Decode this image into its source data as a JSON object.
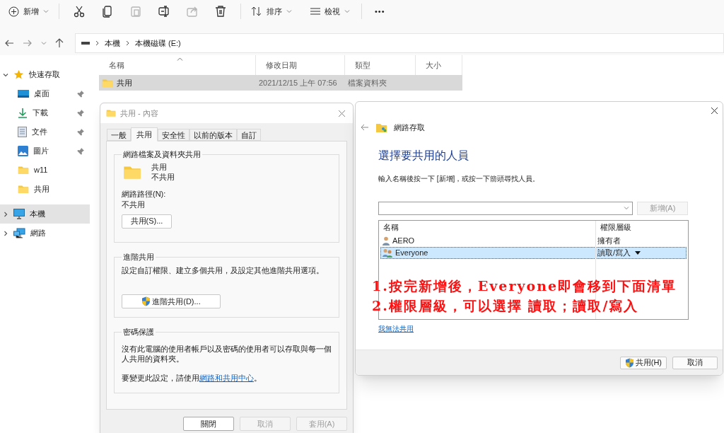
{
  "toolbar": {
    "new_label": "新增",
    "sort_label": "排序",
    "view_label": "檢視",
    "more_label": "•••",
    "icon_buttons": [
      {
        "kind": "cut",
        "disabled": false
      },
      {
        "kind": "copy",
        "disabled": false
      },
      {
        "kind": "paste",
        "disabled": true
      },
      {
        "kind": "rename",
        "disabled": false
      },
      {
        "kind": "share",
        "disabled": true
      },
      {
        "kind": "delete",
        "disabled": false
      }
    ]
  },
  "address": {
    "crumbs": [
      "本機",
      "本機磁碟 (E:)"
    ]
  },
  "sidebar": {
    "items": [
      {
        "label": "快速存取",
        "kind": "star",
        "expanded": true,
        "selected": false,
        "children": [
          {
            "label": "桌面",
            "kind": "desktop",
            "pinned": true,
            "selected": false
          },
          {
            "label": "下載",
            "kind": "download",
            "pinned": true,
            "selected": false
          },
          {
            "label": "文件",
            "kind": "document",
            "pinned": true,
            "selected": false
          },
          {
            "label": "圖片",
            "kind": "image",
            "pinned": true,
            "selected": false
          },
          {
            "label": "w11",
            "kind": "folder",
            "pinned": false,
            "selected": false
          },
          {
            "label": "共用",
            "kind": "folder",
            "pinned": false,
            "selected": false
          }
        ]
      },
      {
        "label": "本機",
        "kind": "pc",
        "expanded": false,
        "selected": true
      },
      {
        "label": "網路",
        "kind": "network",
        "expanded": false,
        "selected": false
      }
    ]
  },
  "file_list": {
    "columns": [
      "名稱",
      "修改日期",
      "類型",
      "大小"
    ],
    "rows": [
      {
        "name": "共用",
        "modified": "2021/12/15 上午 07:56",
        "type": "檔案資料夾",
        "selected": true
      }
    ]
  },
  "properties_dialog": {
    "title": "共用 - 內容",
    "tabs": [
      {
        "label": "一般",
        "selected": false
      },
      {
        "label": "共用",
        "selected": true
      },
      {
        "label": "安全性",
        "selected": false
      },
      {
        "label": "以前的版本",
        "selected": false
      },
      {
        "label": "自訂",
        "selected": false
      }
    ],
    "network_group": {
      "title": "網路檔案及資料夾共用",
      "folder_name": "共用",
      "status": "不共用",
      "path_label": "網路路徑(N):",
      "path_value": "不共用",
      "button": "共用(S)..."
    },
    "advanced_group": {
      "title": "進階共用",
      "description": "設定自訂權限、建立多個共用，及設定其他進階共用選項。",
      "button": "進階共用(D)..."
    },
    "password_group": {
      "title": "密碼保護",
      "description": "沒有此電腦的使用者帳戶以及密碼的使用者可以存取與每一個人共用的資料夾。",
      "change_prefix": "要變更此設定，請使用",
      "change_link": "網路和共用中心",
      "change_suffix": "。"
    },
    "buttons": [
      {
        "label": "關閉",
        "disabled": false
      },
      {
        "label": "取消",
        "disabled": true
      },
      {
        "label": "套用(A)",
        "disabled": true
      }
    ]
  },
  "share_dialog": {
    "title": "網路存取",
    "heading": "選擇要共用的人員",
    "instruction": "輸入名稱後按一下 [新增]，或按一下箭頭尋找人員。",
    "add_button": {
      "label": "新增(A)",
      "disabled": true
    },
    "columns": [
      "名稱",
      "權限層級"
    ],
    "people": [
      {
        "name": "AERO",
        "kind": "user",
        "permission": "擁有者",
        "selected": false,
        "has_dropdown": false
      },
      {
        "name": "Everyone",
        "kind": "group",
        "permission": "讀取/寫入",
        "selected": true,
        "has_dropdown": true
      }
    ],
    "help_link": "我無法共用",
    "buttons": [
      {
        "label": "共用(H)",
        "shield": true
      },
      {
        "label": "取消",
        "shield": false
      }
    ]
  },
  "annotation": {
    "lines": [
      "1.按完新增後，Everyone即會移到下面清單",
      "2.權限層級，可以選擇 讀取；讀取/寫入"
    ]
  }
}
